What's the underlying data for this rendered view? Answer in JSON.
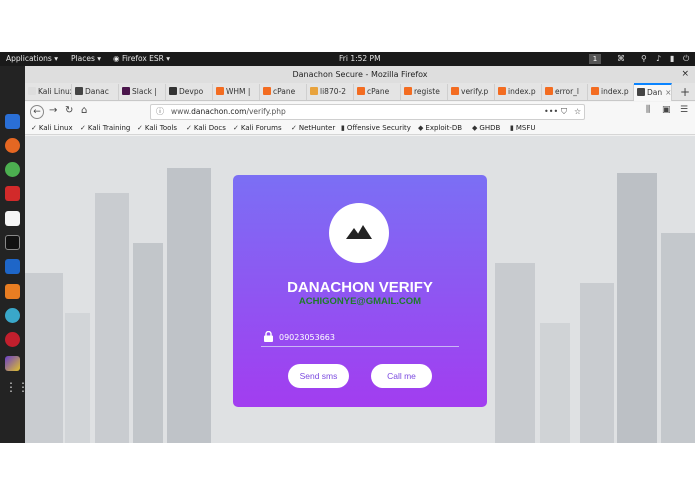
{
  "topbar": {
    "applications": "Applications ▾",
    "places": "Places ▾",
    "firefox": "Firefox ESR ▾",
    "clock": "Fri 1:52 PM",
    "workspace": "1"
  },
  "window": {
    "title": "Danachon Secure - Mozilla Firefox"
  },
  "tabs": [
    {
      "label": "Kali Linux",
      "color": "#dddddd"
    },
    {
      "label": "Danac",
      "color": "#444444"
    },
    {
      "label": "Slack |",
      "color": "#4a154b"
    },
    {
      "label": "Devpo",
      "color": "#333333"
    },
    {
      "label": "WHM |",
      "color": "#f36c21"
    },
    {
      "label": "cPane",
      "color": "#f36c21"
    },
    {
      "label": "li870-2",
      "color": "#e8a33d"
    },
    {
      "label": "cPane",
      "color": "#f36c21"
    },
    {
      "label": "registe",
      "color": "#f36c21"
    },
    {
      "label": "verify.p",
      "color": "#f36c21"
    },
    {
      "label": "index.p",
      "color": "#f36c21"
    },
    {
      "label": "error_l",
      "color": "#f36c21"
    },
    {
      "label": "index.p",
      "color": "#f36c21"
    },
    {
      "label": "Dan",
      "color": "#444444"
    }
  ],
  "url": {
    "prefix": "www.",
    "domain": "danachon.com",
    "path": "/verify.php"
  },
  "bookmarks": [
    {
      "label": "Kali Linux",
      "icon": "✓"
    },
    {
      "label": "Kali Training",
      "icon": "✓"
    },
    {
      "label": "Kali Tools",
      "icon": "✓"
    },
    {
      "label": "Kali Docs",
      "icon": "✓"
    },
    {
      "label": "Kali Forums",
      "icon": "✓"
    },
    {
      "label": "NetHunter",
      "icon": "✓"
    },
    {
      "label": "Offensive Security",
      "icon": "▮"
    },
    {
      "label": "Exploit-DB",
      "icon": "◆"
    },
    {
      "label": "GHDB",
      "icon": "◆"
    },
    {
      "label": "MSFU",
      "icon": "▮"
    }
  ],
  "card": {
    "title": "DANACHON VERIFY",
    "email": "ACHIGONYE@GMAIL.COM",
    "phone": "09023053663",
    "send_sms": "Send sms",
    "call_me": "Call me"
  },
  "colors": {
    "card_top": "#7b6ff4",
    "card_bottom": "#a23df0",
    "email": "#1f7a2a",
    "button_text": "#7c4be0"
  }
}
